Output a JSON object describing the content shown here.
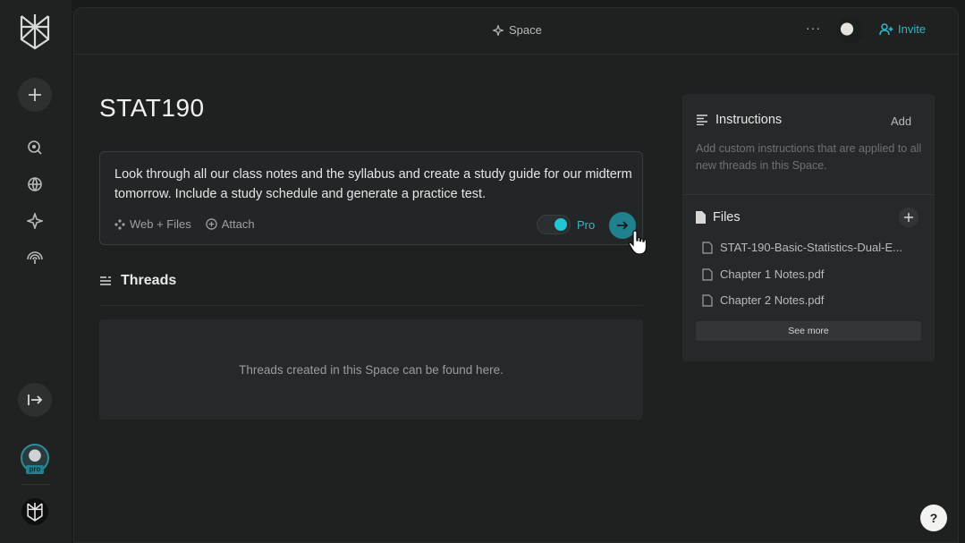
{
  "topbar": {
    "crumb": "Space",
    "more": "···",
    "invite": "Invite"
  },
  "space": {
    "title": "STAT190"
  },
  "composer": {
    "text": "Look through all our class notes and the syllabus and create a study guide for our midterm tomorrow. Include a study schedule and generate a practice test.",
    "source_label": "Web + Files",
    "attach_label": "Attach",
    "pro_label": "Pro",
    "pro_enabled": true
  },
  "threads": {
    "heading": "Threads",
    "empty_text": "Threads created in this Space can be found here."
  },
  "sidebar": {
    "instructions": {
      "title": "Instructions",
      "add_label": "Add",
      "placeholder": "Add custom instructions that are applied to all new threads in this Space."
    },
    "files": {
      "title": "Files",
      "items": [
        "STAT-190-Basic-Statistics-Dual-E...",
        "Chapter 1 Notes.pdf",
        "Chapter 2 Notes.pdf"
      ],
      "see_more": "See more"
    }
  },
  "rail": {
    "pro_badge": "pro"
  },
  "help_label": "?",
  "colors": {
    "accent": "#20808d",
    "accent_text": "#30b8c6",
    "background": "#191a1a"
  }
}
